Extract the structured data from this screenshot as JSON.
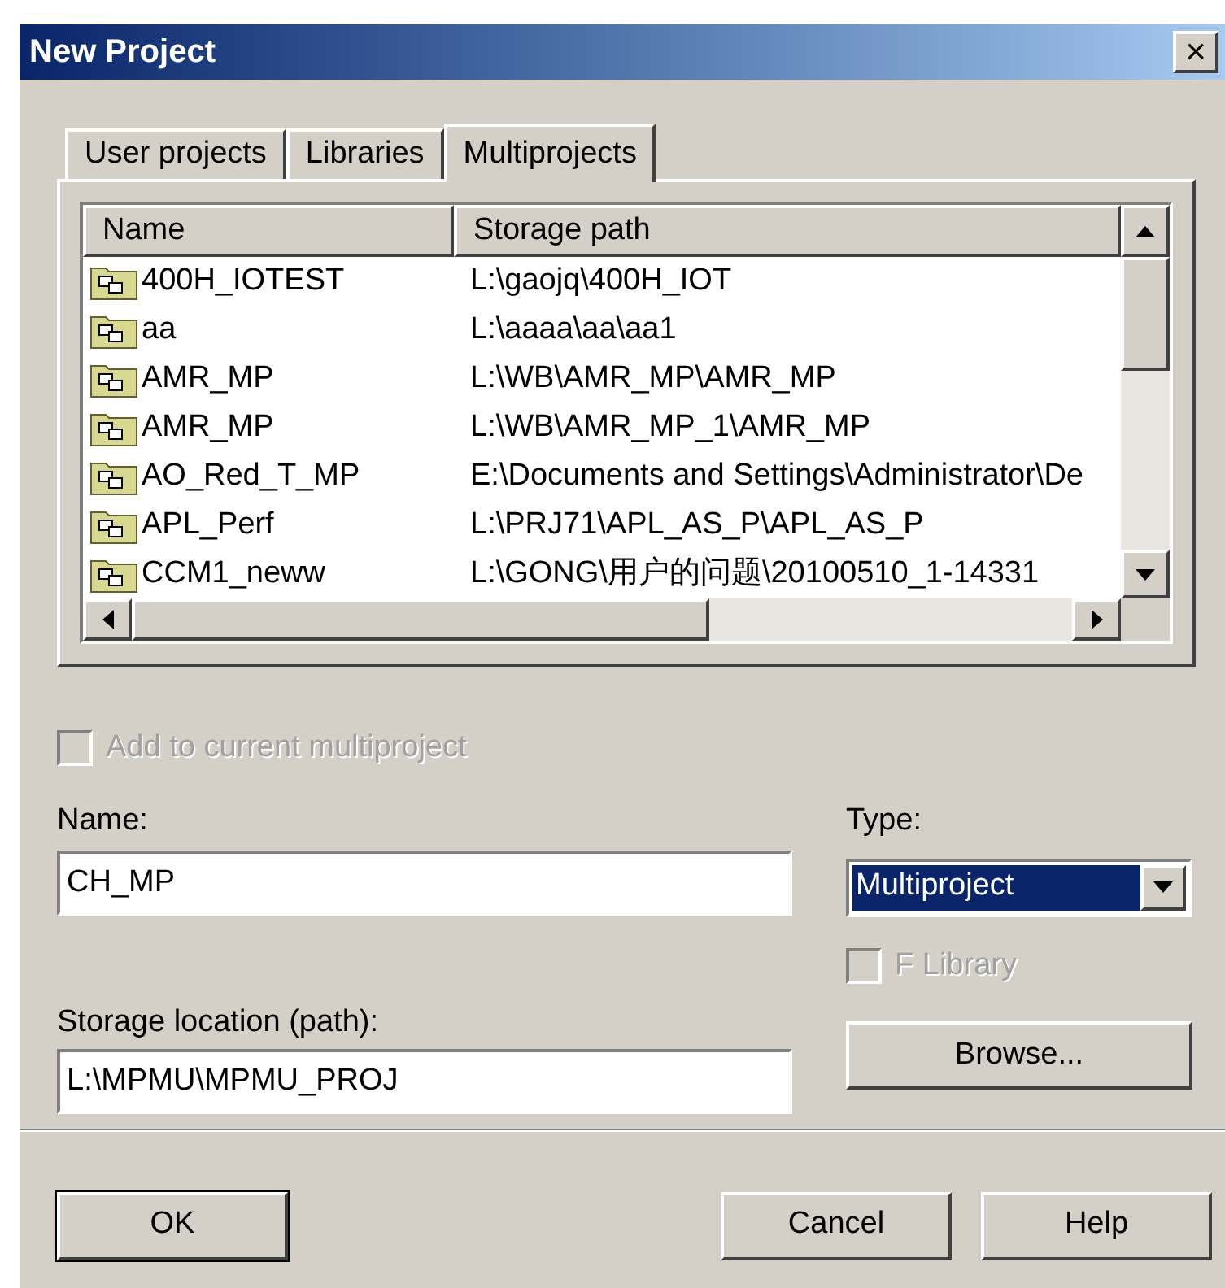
{
  "window": {
    "title": "New Project",
    "close_label": "×"
  },
  "tabs": [
    {
      "label": "User projects",
      "selected": false
    },
    {
      "label": "Libraries",
      "selected": false
    },
    {
      "label": "Multiprojects",
      "selected": true
    }
  ],
  "table": {
    "columns": [
      "Name",
      "Storage path"
    ],
    "rows": [
      {
        "name": "400H_IOTEST",
        "path": "L:\\gaojq\\400H_IOT"
      },
      {
        "name": "aa",
        "path": "L:\\aaaa\\aa\\aa1"
      },
      {
        "name": "AMR_MP",
        "path": "L:\\WB\\AMR_MP\\AMR_MP"
      },
      {
        "name": "AMR_MP",
        "path": "L:\\WB\\AMR_MP_1\\AMR_MP"
      },
      {
        "name": "AO_Red_T_MP",
        "path": "E:\\Documents and Settings\\Administrator\\De"
      },
      {
        "name": "APL_Perf",
        "path": "L:\\PRJ71\\APL_AS_P\\APL_AS_P"
      },
      {
        "name": "CCM1_neww",
        "path": "L:\\GONG\\用户的问题\\20100510_1-14331"
      }
    ]
  },
  "add_to_current": {
    "label": "Add to current multiproject",
    "checked": false,
    "disabled": true
  },
  "name_field": {
    "label": "Name:",
    "value": "CH_MP"
  },
  "type_field": {
    "label": "Type:",
    "value": "Multiproject"
  },
  "f_library": {
    "label": "F Library",
    "checked": false,
    "disabled": true
  },
  "storage_field": {
    "label": "Storage location (path):",
    "value": "L:\\MPMU\\MPMU_PROJ"
  },
  "browse_button": "Browse...",
  "buttons": [
    {
      "label": "OK",
      "default": true
    },
    {
      "label": "Cancel",
      "default": false
    },
    {
      "label": "Help",
      "default": false
    }
  ]
}
